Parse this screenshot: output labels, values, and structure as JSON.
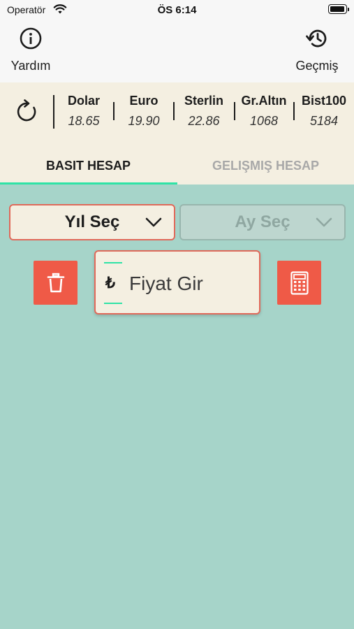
{
  "status_bar": {
    "carrier": "Operatör",
    "time": "ÖS 6:14"
  },
  "top_bar": {
    "help": {
      "label": "Yardım",
      "icon": "info-icon"
    },
    "history": {
      "label": "Geçmiş",
      "icon": "history-icon"
    }
  },
  "rates": {
    "refresh_icon": "refresh-icon",
    "items": [
      {
        "name": "Dolar",
        "value": "18.65"
      },
      {
        "name": "Euro",
        "value": "19.90"
      },
      {
        "name": "Sterlin",
        "value": "22.86"
      },
      {
        "name": "Gr.Altın",
        "value": "1068"
      },
      {
        "name": "Bist100",
        "value": "5184"
      }
    ]
  },
  "tabs": [
    {
      "label": "BASIT HESAP",
      "active": true
    },
    {
      "label": "GELIŞMIŞ HESAP",
      "active": false
    }
  ],
  "form": {
    "year_select": {
      "label": "Yıl Seç"
    },
    "month_select": {
      "label": "Ay Seç"
    },
    "price_input": {
      "currency_symbol": "₺",
      "placeholder": "Fiyat Gir",
      "value": ""
    },
    "delete_icon": "trash-icon",
    "calculate_icon": "calculator-icon"
  },
  "colors": {
    "background": "#a6d4c9",
    "accent_red": "#ef5a47",
    "accent_green": "#2fe3a6",
    "panel": "#f4efe1"
  }
}
